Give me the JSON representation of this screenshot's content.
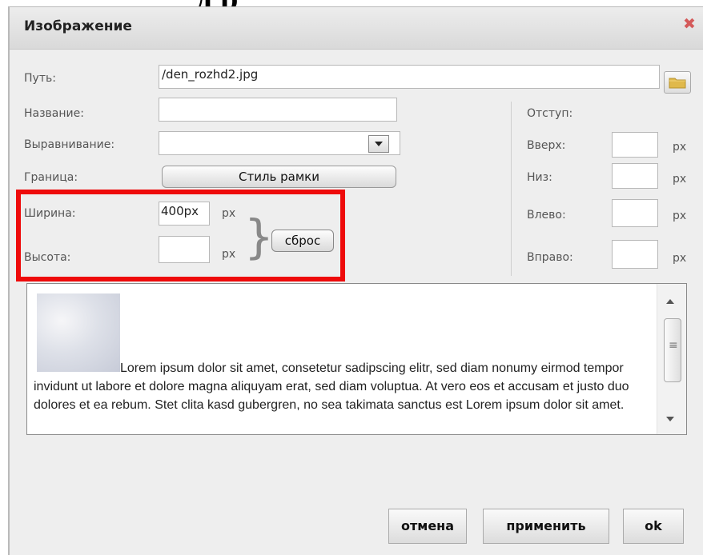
{
  "top_title": "д    р",
  "dialog": {
    "title": "Изображение",
    "close_icon": "close-icon"
  },
  "fields": {
    "path_label": "Путь:",
    "path_value": "/den_rozhd2.jpg",
    "name_label": "Название:",
    "name_value": "",
    "align_label": "Выравнивание:",
    "align_value": "",
    "border_label": "Граница:",
    "border_button": "Стиль рамки",
    "width_label": "Ширина:",
    "width_value": "400px",
    "height_label": "Высота:",
    "height_value": "",
    "px_unit": "px",
    "reset_button": "сброс"
  },
  "indent": {
    "title": "Отступ:",
    "top_label": "Вверх:",
    "bottom_label": "Низ:",
    "left_label": "Влево:",
    "right_label": "Вправо:",
    "px_unit": "px"
  },
  "preview": {
    "text": "Lorem ipsum dolor sit amet, consetetur sadipscing elitr, sed diam nonumy eirmod tempor invidunt ut labore et dolore magna aliquyam erat, sed diam voluptua. At vero eos et accusam et justo duo dolores et ea rebum. Stet clita kasd gubergren, no sea takimata sanctus est Lorem ipsum dolor sit amet."
  },
  "footer": {
    "cancel": "отмена",
    "apply": "применить",
    "ok": "ok"
  },
  "colors": {
    "highlight": "#ee0a0a",
    "close": "#d45a5a"
  }
}
